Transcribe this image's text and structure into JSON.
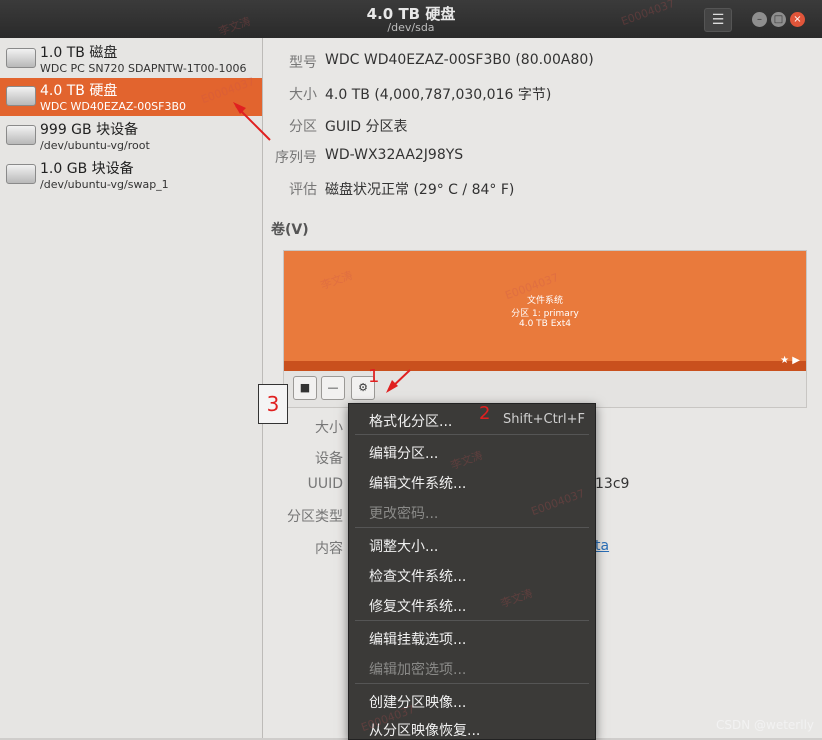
{
  "window": {
    "title": "4.0 TB 硬盘",
    "subtitle": "/dev/sda",
    "menu_icon": "hamburger-icon",
    "min_glyph": "–",
    "max_glyph": "□",
    "close_glyph": "×"
  },
  "sidebar": {
    "drives": [
      {
        "name": "1.0 TB 磁盘",
        "sub": "WDC PC SN720 SDAPNTW-1T00-1006"
      },
      {
        "name": "4.0 TB 硬盘",
        "sub": "WDC WD40EZAZ-00SF3B0"
      },
      {
        "name": "999 GB 块设备",
        "sub": "/dev/ubuntu-vg/root"
      },
      {
        "name": "1.0 GB 块设备",
        "sub": "/dev/ubuntu-vg/swap_1"
      }
    ]
  },
  "disk_info": {
    "model_label": "型号",
    "model_value": "WDC WD40EZAZ-00SF3B0 (80.00A80)",
    "size_label": "大小",
    "size_value": "4.0 TB (4,000,787,030,016 字节)",
    "partition_label": "分区",
    "partition_value": "GUID 分区表",
    "serial_label": "序列号",
    "serial_value": "WD-WX32AA2J98YS",
    "assessment_label": "评估",
    "assessment_value": "磁盘状况正常 (29° C / 84° F)"
  },
  "volumes": {
    "title": "卷(V)",
    "bar_line1": "文件系统",
    "bar_line2": "分区 1: primary",
    "bar_line3": "4.0 TB Ext4",
    "star_glyph": "★ ▶",
    "stop_glyph": "■",
    "minus_glyph": "—",
    "gear_glyph": "⚙"
  },
  "details": {
    "size_label": "大小",
    "device_label": "设备",
    "uuid_label": "UUID",
    "uuid_tail": "13c9",
    "type_label": "分区类型",
    "content_label": "内容",
    "content_tail": "ta"
  },
  "context_menu": {
    "format": "格式化分区...",
    "format_accel": "Shift+Ctrl+F",
    "edit_partition": "编辑分区...",
    "edit_fs": "编辑文件系统...",
    "change_password": "更改密码...",
    "resize": "调整大小...",
    "check_fs": "检查文件系统...",
    "repair_fs": "修复文件系统...",
    "edit_mount": "编辑挂载选项...",
    "edit_crypt": "编辑加密选项...",
    "create_image": "创建分区映像...",
    "restore_image": "从分区映像恢复..."
  },
  "annotations": {
    "n1": "1",
    "n2": "2",
    "n3": "3"
  },
  "watermarks": [
    "李文涛",
    "E0004037"
  ],
  "credit": "CSDN @weterlly",
  "colors": {
    "accent": "#e2642e",
    "annotation": "#e02020",
    "menu_bg": "#3b3a38"
  }
}
